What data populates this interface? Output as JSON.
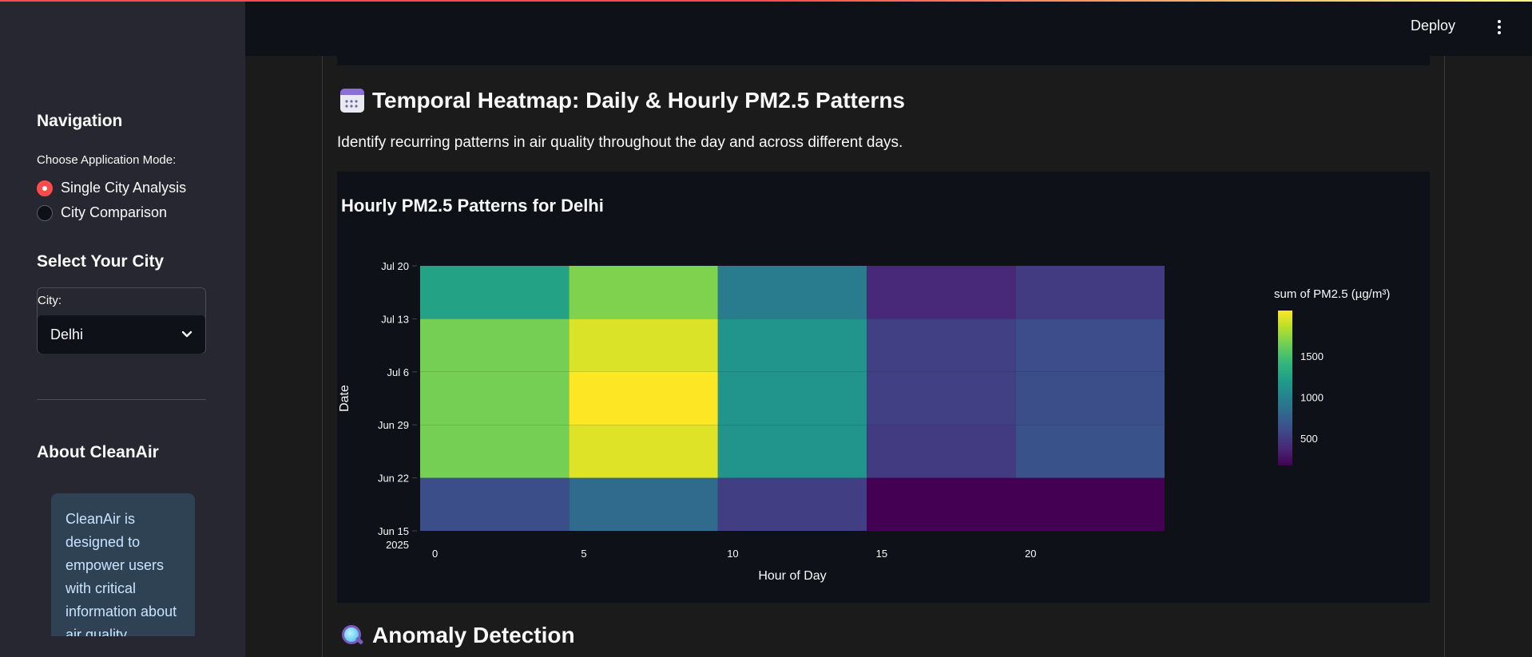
{
  "header": {
    "deploy_label": "Deploy",
    "menu_icon": "kebab-menu-icon"
  },
  "sidebar": {
    "nav_title": "Navigation",
    "mode_label": "Choose Application Mode:",
    "modes": [
      {
        "label": "Single City Analysis",
        "selected": true
      },
      {
        "label": "City Comparison",
        "selected": false
      }
    ],
    "city_title": "Select Your City",
    "city_field_label": "City:",
    "city_value": "Delhi",
    "about_title": "About CleanAir",
    "about_text": "CleanAir is designed to empower users with critical information about air quality"
  },
  "main": {
    "heatmap_section": {
      "icon": "calendar-icon",
      "title": "Temporal Heatmap: Daily & Hourly PM2.5 Patterns",
      "description": "Identify recurring patterns in air quality throughout the day and across different days."
    },
    "anomaly_section": {
      "icon": "magnifier-icon",
      "title": "Anomaly Detection"
    }
  },
  "colors": {
    "accent": "#ff4b4b",
    "background": "#0e1117",
    "sidebar": "#262730"
  },
  "chart_data": {
    "type": "heatmap",
    "title": "Hourly PM2.5 Patterns for Delhi",
    "xlabel": "Hour of Day",
    "ylabel": "Date",
    "colorbar_title": "sum of PM2.5 (µg/m³)",
    "colorscale": "viridis",
    "x_bins": [
      [
        -0.5,
        4.5
      ],
      [
        4.5,
        9.5
      ],
      [
        9.5,
        14.5
      ],
      [
        14.5,
        19.5
      ],
      [
        19.5,
        24.5
      ]
    ],
    "x_ticks": [
      0,
      5,
      10,
      15,
      20
    ],
    "x_range": [
      -0.5,
      24.5
    ],
    "y_ticks": [
      {
        "date": "2025-06-15",
        "label": "Jun 15",
        "sublabel": "2025"
      },
      {
        "date": "2025-06-22",
        "label": "Jun 22"
      },
      {
        "date": "2025-06-29",
        "label": "Jun 29"
      },
      {
        "date": "2025-07-06",
        "label": "Jul 6"
      },
      {
        "date": "2025-07-13",
        "label": "Jul 13"
      },
      {
        "date": "2025-07-20",
        "label": "Jul 20"
      }
    ],
    "y_range": [
      "2025-06-15",
      "2025-07-20"
    ],
    "y_bins": [
      [
        "2025-06-15",
        "2025-06-22"
      ],
      [
        "2025-06-22",
        "2025-06-29"
      ],
      [
        "2025-06-29",
        "2025-07-06"
      ],
      [
        "2025-07-06",
        "2025-07-13"
      ],
      [
        "2025-07-13",
        "2025-07-20"
      ]
    ],
    "z": [
      [
        620,
        820,
        520,
        170,
        170
      ],
      [
        1650,
        1960,
        1150,
        500,
        650
      ],
      [
        1650,
        2050,
        1150,
        530,
        620
      ],
      [
        1650,
        1950,
        1150,
        530,
        610
      ],
      [
        1250,
        1680,
        950,
        380,
        500
      ]
    ],
    "z_range": [
      170,
      2050
    ],
    "colorbar_ticks": [
      500,
      1000,
      1500
    ]
  }
}
